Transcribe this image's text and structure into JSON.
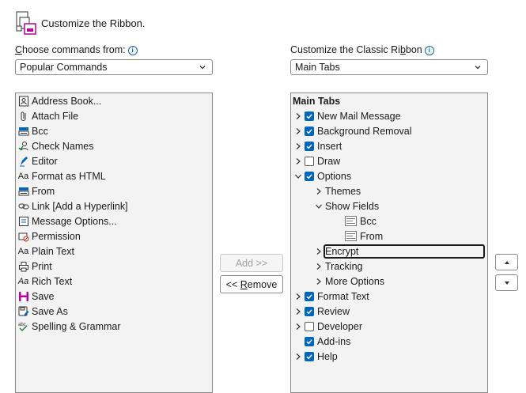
{
  "header": {
    "title": "Customize the Ribbon."
  },
  "left": {
    "label_prefix": "",
    "label_mnemonic": "C",
    "label_rest": "hoose commands from:",
    "dropdown_value": "Popular Commands",
    "commands": [
      {
        "label": "Address Book...",
        "icon": "address-book-icon"
      },
      {
        "label": "Attach File",
        "icon": "paperclip-icon"
      },
      {
        "label": "Bcc",
        "icon": "bcc-icon"
      },
      {
        "label": "Check Names",
        "icon": "check-names-icon"
      },
      {
        "label": "Editor",
        "icon": "editor-pen-icon"
      },
      {
        "label": "Format as HTML",
        "icon": "format-html-icon"
      },
      {
        "label": "From",
        "icon": "from-icon"
      },
      {
        "label": "Link [Add a Hyperlink]",
        "icon": "link-icon"
      },
      {
        "label": "Message Options...",
        "icon": "message-options-icon"
      },
      {
        "label": "Permission",
        "icon": "permission-icon"
      },
      {
        "label": "Plain Text",
        "icon": "plain-text-icon"
      },
      {
        "label": "Print",
        "icon": "printer-icon"
      },
      {
        "label": "Rich Text",
        "icon": "rich-text-icon"
      },
      {
        "label": "Save",
        "icon": "save-icon"
      },
      {
        "label": "Save As",
        "icon": "save-as-icon"
      },
      {
        "label": "Spelling & Grammar",
        "icon": "spelling-icon"
      }
    ]
  },
  "middle": {
    "add_label": "Add >>",
    "remove_prefix": "<< ",
    "remove_mnemonic": "R",
    "remove_rest": "emove"
  },
  "right": {
    "label_prefix": "Customize the Classic Ri",
    "label_mnemonic": "b",
    "label_rest": "bon",
    "dropdown_value": "Main Tabs",
    "tree_header": "Main Tabs",
    "tree": [
      {
        "label": "New Mail Message",
        "level": 0,
        "expander": "collapsed",
        "checkbox": "checked"
      },
      {
        "label": "Background Removal",
        "level": 0,
        "expander": "collapsed",
        "checkbox": "checked"
      },
      {
        "label": "Insert",
        "level": 0,
        "expander": "collapsed",
        "checkbox": "checked"
      },
      {
        "label": "Draw",
        "level": 0,
        "expander": "collapsed",
        "checkbox": "unchecked"
      },
      {
        "label": "Options",
        "level": 0,
        "expander": "expanded",
        "checkbox": "checked"
      },
      {
        "label": "Themes",
        "level": 1,
        "expander": "collapsed",
        "checkbox": "none"
      },
      {
        "label": "Show Fields",
        "level": 1,
        "expander": "expanded",
        "checkbox": "none"
      },
      {
        "label": "Bcc",
        "level": 2,
        "expander": "none",
        "checkbox": "none",
        "icon": "bcc-field-icon"
      },
      {
        "label": "From",
        "level": 2,
        "expander": "none",
        "checkbox": "none",
        "icon": "from-field-icon"
      },
      {
        "label": "Encrypt",
        "level": 1,
        "expander": "collapsed",
        "checkbox": "none",
        "focused": true
      },
      {
        "label": "Tracking",
        "level": 1,
        "expander": "collapsed",
        "checkbox": "none"
      },
      {
        "label": "More Options",
        "level": 1,
        "expander": "collapsed",
        "checkbox": "none"
      },
      {
        "label": "Format Text",
        "level": 0,
        "expander": "collapsed",
        "checkbox": "checked"
      },
      {
        "label": "Review",
        "level": 0,
        "expander": "collapsed",
        "checkbox": "checked"
      },
      {
        "label": "Developer",
        "level": 0,
        "expander": "collapsed",
        "checkbox": "unchecked"
      },
      {
        "label": "Add-ins",
        "level": 0,
        "expander": "none",
        "checkbox": "checked"
      },
      {
        "label": "Help",
        "level": 0,
        "expander": "collapsed",
        "checkbox": "checked"
      }
    ]
  },
  "colors": {
    "accent": "#0067c0",
    "list_bg": "#f3f3f3",
    "border": "#8a8a8a"
  }
}
